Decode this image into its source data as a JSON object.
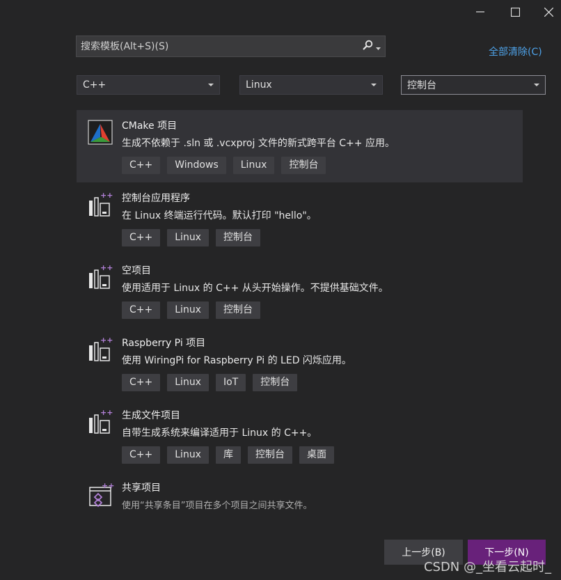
{
  "window": {
    "controls": [
      "minimize-icon",
      "maximize-icon",
      "close-icon"
    ]
  },
  "search": {
    "placeholder": "搜索模板(Alt+S)(S)",
    "icon": "search-icon"
  },
  "clear_all": "全部清除(C)",
  "filters": {
    "language": "C++",
    "platform": "Linux",
    "project_type": "控制台"
  },
  "templates": [
    {
      "title": "CMake 项目",
      "description": "生成不依赖于 .sln 或 .vcxproj 文件的新式跨平台 C++ 应用。",
      "tags": [
        "C++",
        "Windows",
        "Linux",
        "控制台"
      ],
      "icon": "cmake-icon"
    },
    {
      "title": "控制台应用程序",
      "description": "在 Linux 终端运行代码。默认打印 \"hello\"。",
      "tags": [
        "C++",
        "Linux",
        "控制台"
      ],
      "icon": "linux-cpp-project-icon"
    },
    {
      "title": "空项目",
      "description": "使用适用于 Linux 的 C++ 从头开始操作。不提供基础文件。",
      "tags": [
        "C++",
        "Linux",
        "控制台"
      ],
      "icon": "linux-cpp-project-icon"
    },
    {
      "title": "Raspberry Pi 项目",
      "description": "使用 WiringPi for Raspberry Pi 的 LED 闪烁应用。",
      "tags": [
        "C++",
        "Linux",
        "IoT",
        "控制台"
      ],
      "icon": "linux-cpp-project-icon"
    },
    {
      "title": "生成文件项目",
      "description": "自带生成系统来编译适用于 Linux 的 C++。",
      "tags": [
        "C++",
        "Linux",
        "库",
        "控制台",
        "桌面"
      ],
      "icon": "linux-cpp-project-icon"
    },
    {
      "title": "共享项目",
      "description": "使用“共享条目”项目在多个项目之间共享文件。",
      "tags": [],
      "icon": "shared-project-icon"
    }
  ],
  "buttons": {
    "back": "上一步(B)",
    "next": "下一步(N)"
  },
  "watermark": "CSDN @_坐看云起时_",
  "colors": {
    "background": "#252526",
    "selected_row": "#333337",
    "tag_bg": "#3e3e42",
    "accent_link": "#4ea2e8",
    "primary_button": "#68217a"
  }
}
